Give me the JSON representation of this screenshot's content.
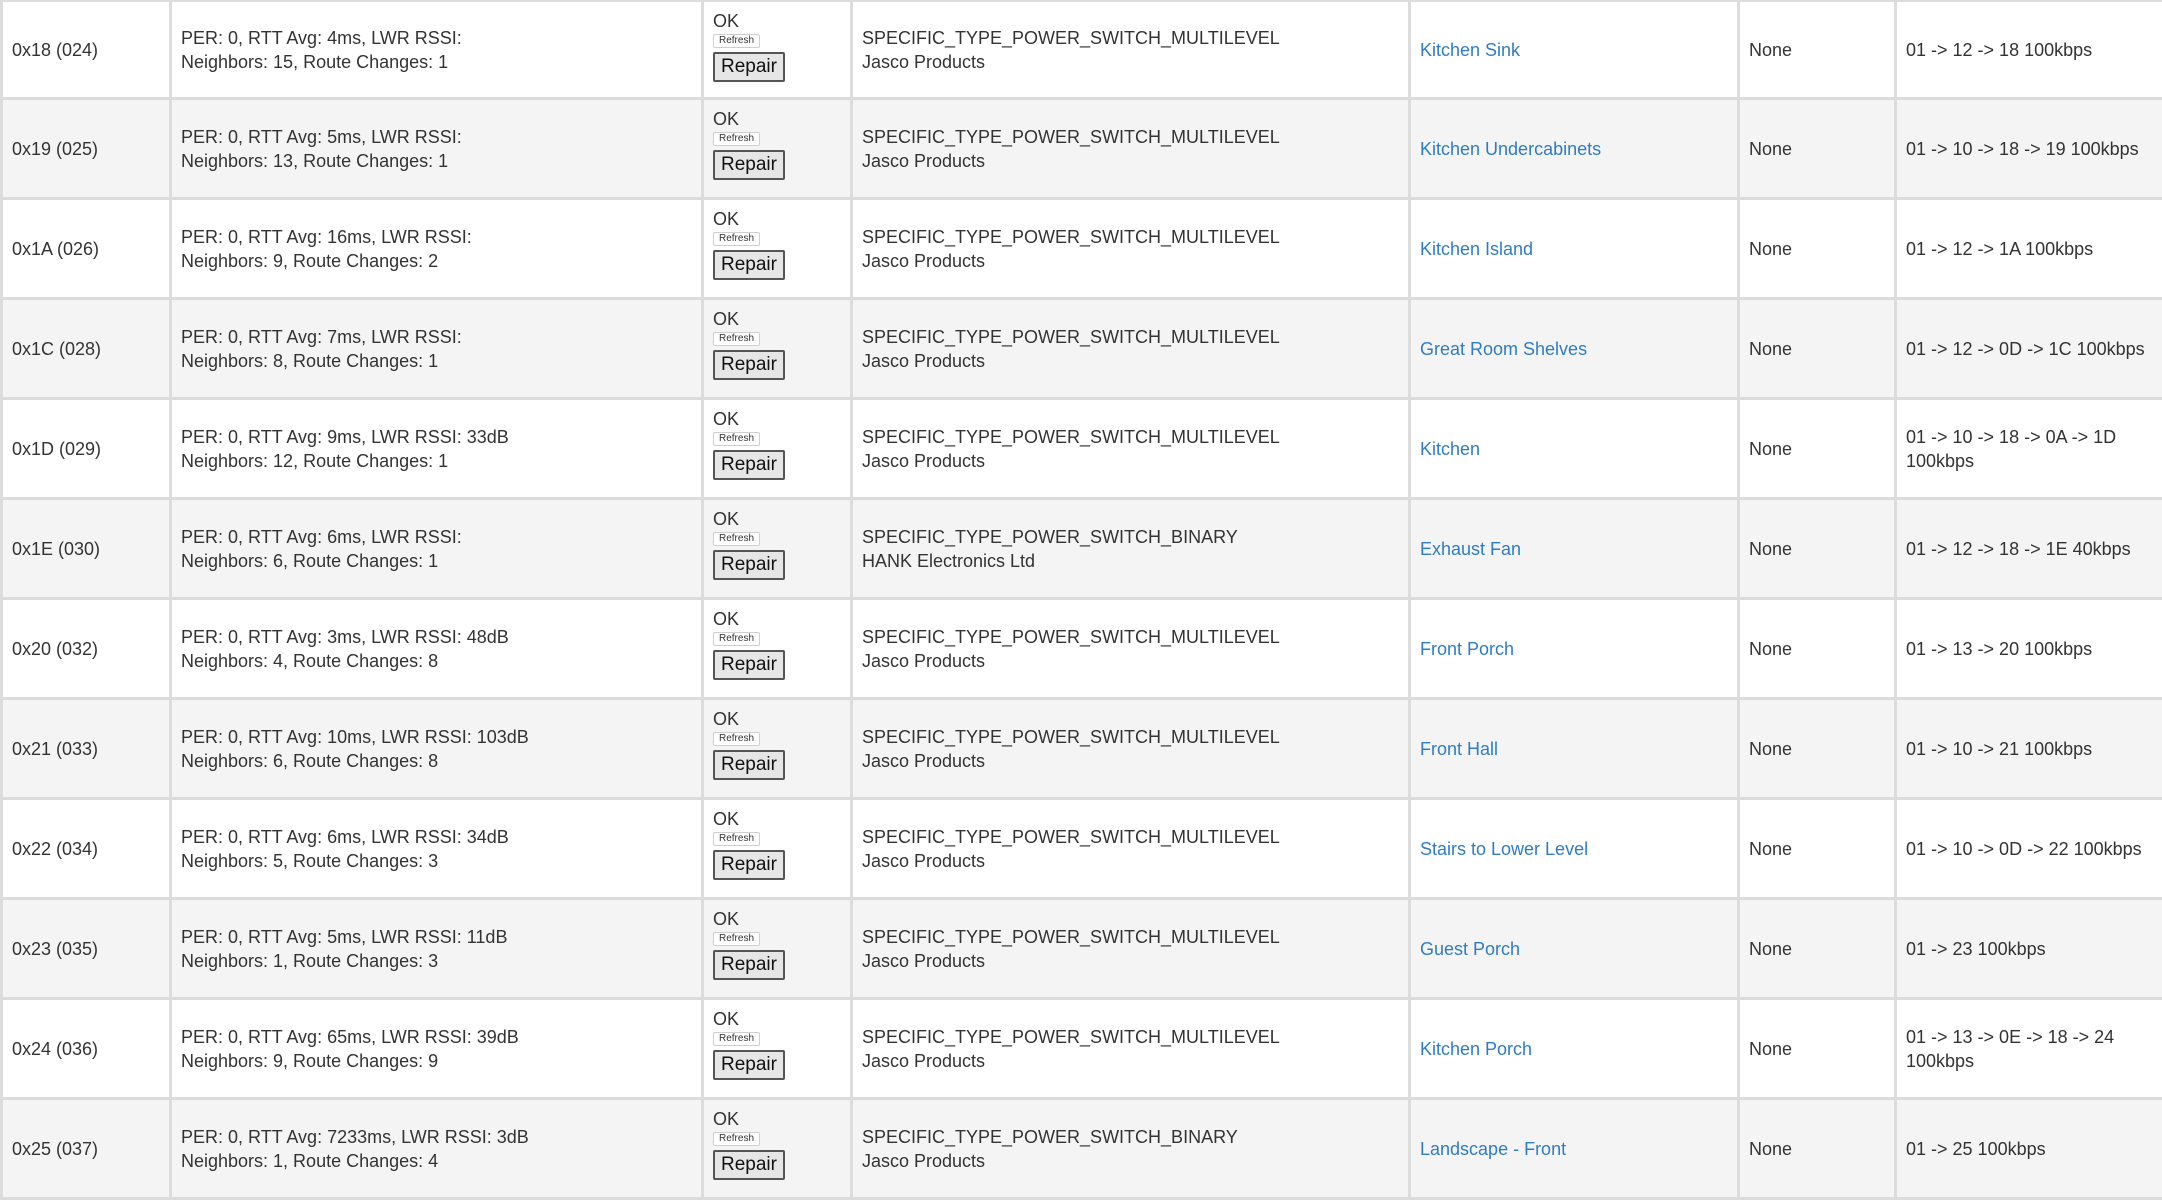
{
  "rows": [
    {
      "id": "0x18 (024)",
      "stats1": "PER: 0, RTT Avg: 4ms, LWR RSSI:",
      "stats2": "Neighbors: 15, Route Changes: 1",
      "status": "OK",
      "refresh": "Refresh",
      "repair": "Repair",
      "type": "SPECIFIC_TYPE_POWER_SWITCH_MULTILEVEL",
      "manufacturer": "Jasco Products",
      "name": "Kitchen Sink",
      "security": "None",
      "route": "01 -> 12 -> 18 100kbps"
    },
    {
      "id": "0x19 (025)",
      "stats1": "PER: 0, RTT Avg: 5ms, LWR RSSI:",
      "stats2": "Neighbors: 13, Route Changes: 1",
      "status": "OK",
      "refresh": "Refresh",
      "repair": "Repair",
      "type": "SPECIFIC_TYPE_POWER_SWITCH_MULTILEVEL",
      "manufacturer": "Jasco Products",
      "name": "Kitchen Undercabinets",
      "security": "None",
      "route": "01 -> 10 -> 18 -> 19 100kbps"
    },
    {
      "id": "0x1A (026)",
      "stats1": "PER: 0, RTT Avg: 16ms, LWR RSSI:",
      "stats2": "Neighbors: 9, Route Changes: 2",
      "status": "OK",
      "refresh": "Refresh",
      "repair": "Repair",
      "type": "SPECIFIC_TYPE_POWER_SWITCH_MULTILEVEL",
      "manufacturer": "Jasco Products",
      "name": "Kitchen Island",
      "security": "None",
      "route": "01 -> 12 -> 1A 100kbps"
    },
    {
      "id": "0x1C (028)",
      "stats1": "PER: 0, RTT Avg: 7ms, LWR RSSI:",
      "stats2": "Neighbors: 8, Route Changes: 1",
      "status": "OK",
      "refresh": "Refresh",
      "repair": "Repair",
      "type": "SPECIFIC_TYPE_POWER_SWITCH_MULTILEVEL",
      "manufacturer": "Jasco Products",
      "name": "Great Room Shelves",
      "security": "None",
      "route": "01 -> 12 -> 0D -> 1C 100kbps"
    },
    {
      "id": "0x1D (029)",
      "stats1": "PER: 0, RTT Avg: 9ms, LWR RSSI: 33dB",
      "stats2": "Neighbors: 12, Route Changes: 1",
      "status": "OK",
      "refresh": "Refresh",
      "repair": "Repair",
      "type": "SPECIFIC_TYPE_POWER_SWITCH_MULTILEVEL",
      "manufacturer": "Jasco Products",
      "name": "Kitchen",
      "security": "None",
      "route": "01 -> 10 -> 18 -> 0A -> 1D 100kbps"
    },
    {
      "id": "0x1E (030)",
      "stats1": "PER: 0, RTT Avg: 6ms, LWR RSSI:",
      "stats2": "Neighbors: 6, Route Changes: 1",
      "status": "OK",
      "refresh": "Refresh",
      "repair": "Repair",
      "type": "SPECIFIC_TYPE_POWER_SWITCH_BINARY",
      "manufacturer": "HANK Electronics Ltd",
      "name": "Exhaust Fan",
      "security": "None",
      "route": "01 -> 12 -> 18 -> 1E 40kbps"
    },
    {
      "id": "0x20 (032)",
      "stats1": "PER: 0, RTT Avg: 3ms, LWR RSSI: 48dB",
      "stats2": "Neighbors: 4, Route Changes: 8",
      "status": "OK",
      "refresh": "Refresh",
      "repair": "Repair",
      "type": "SPECIFIC_TYPE_POWER_SWITCH_MULTILEVEL",
      "manufacturer": "Jasco Products",
      "name": "Front Porch",
      "security": "None",
      "route": "01 -> 13 -> 20 100kbps"
    },
    {
      "id": "0x21 (033)",
      "stats1": "PER: 0, RTT Avg: 10ms, LWR RSSI: 103dB",
      "stats2": "Neighbors: 6, Route Changes: 8",
      "status": "OK",
      "refresh": "Refresh",
      "repair": "Repair",
      "type": "SPECIFIC_TYPE_POWER_SWITCH_MULTILEVEL",
      "manufacturer": "Jasco Products",
      "name": "Front Hall",
      "security": "None",
      "route": "01 -> 10 -> 21 100kbps"
    },
    {
      "id": "0x22 (034)",
      "stats1": "PER: 0, RTT Avg: 6ms, LWR RSSI: 34dB",
      "stats2": "Neighbors: 5, Route Changes: 3",
      "status": "OK",
      "refresh": "Refresh",
      "repair": "Repair",
      "type": "SPECIFIC_TYPE_POWER_SWITCH_MULTILEVEL",
      "manufacturer": "Jasco Products",
      "name": "Stairs to Lower Level",
      "security": "None",
      "route": "01 -> 10 -> 0D -> 22 100kbps"
    },
    {
      "id": "0x23 (035)",
      "stats1": "PER: 0, RTT Avg: 5ms, LWR RSSI: 11dB",
      "stats2": "Neighbors: 1, Route Changes: 3",
      "status": "OK",
      "refresh": "Refresh",
      "repair": "Repair",
      "type": "SPECIFIC_TYPE_POWER_SWITCH_MULTILEVEL",
      "manufacturer": "Jasco Products",
      "name": "Guest Porch",
      "security": "None",
      "route": "01 -> 23 100kbps"
    },
    {
      "id": "0x24 (036)",
      "stats1": "PER: 0, RTT Avg: 65ms, LWR RSSI: 39dB",
      "stats2": "Neighbors: 9, Route Changes: 9",
      "status": "OK",
      "refresh": "Refresh",
      "repair": "Repair",
      "type": "SPECIFIC_TYPE_POWER_SWITCH_MULTILEVEL",
      "manufacturer": "Jasco Products",
      "name": "Kitchen Porch",
      "security": "None",
      "route": "01 -> 13 -> 0E -> 18 -> 24 100kbps"
    },
    {
      "id": "0x25 (037)",
      "stats1": "PER: 0, RTT Avg: 7233ms, LWR RSSI: 3dB",
      "stats2": "Neighbors: 1, Route Changes: 4",
      "status": "OK",
      "refresh": "Refresh",
      "repair": "Repair",
      "type": "SPECIFIC_TYPE_POWER_SWITCH_BINARY",
      "manufacturer": "Jasco Products",
      "name": "Landscape - Front",
      "security": "None",
      "route": "01 -> 25 100kbps"
    }
  ]
}
